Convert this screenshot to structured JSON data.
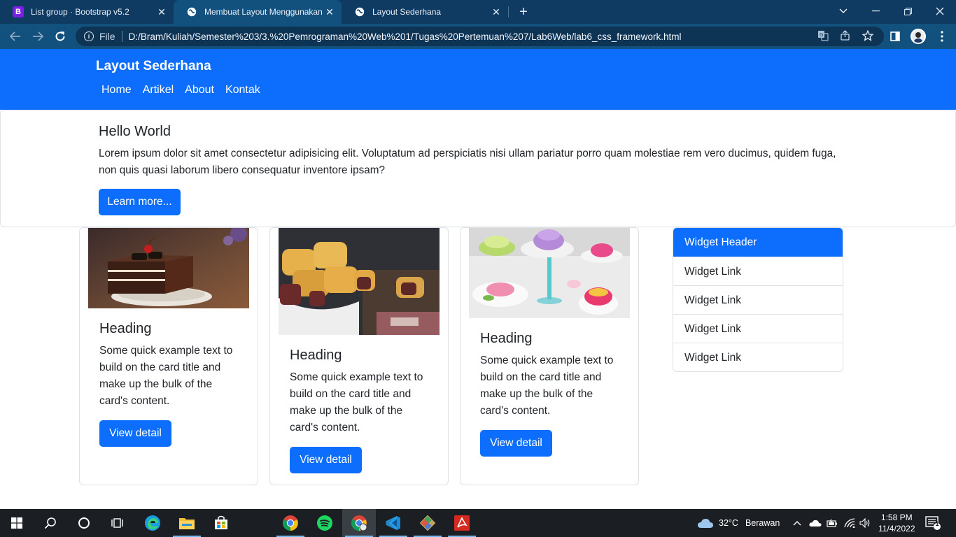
{
  "browser": {
    "tabs": [
      {
        "title": "List group · Bootstrap v5.2",
        "favicon": "bootstrap-icon",
        "close": "✕"
      },
      {
        "title": "Membuat Layout Menggunakan",
        "favicon": "globe-icon",
        "close": "✕"
      },
      {
        "title": "Layout Sederhana",
        "favicon": "globe-icon",
        "close": "✕"
      }
    ],
    "new_tab": "+",
    "address": {
      "scheme_label": "File",
      "url": "D:/Bram/Kuliah/Semester%203/3.%20Pemrograman%20Web%201/Tugas%20Pertemuan%207/Lab6Web/lab6_css_framework.html"
    },
    "icons": [
      "back-arrow-icon",
      "forward-arrow-icon",
      "reload-icon",
      "info-icon",
      "translate-icon",
      "share-icon",
      "star-icon",
      "side-panel-icon",
      "profile-avatar",
      "kebab-menu-icon"
    ]
  },
  "site": {
    "brand": "Layout Sederhana",
    "nav": [
      "Home",
      "Artikel",
      "About",
      "Kontak"
    ]
  },
  "hero": {
    "title": "Hello World",
    "text": "Lorem ipsum dolor sit amet consectetur adipisicing elit. Voluptatum ad perspiciatis nisi ullam pariatur porro quam molestiae rem vero ducimus, quidem fuga, non quis quasi laborum libero consequatur inventore ipsam?",
    "button": "Learn more..."
  },
  "cards": [
    {
      "image": "chocolate-cake-photo",
      "heading": "Heading",
      "text": "Some quick example text to build on the card title and make up the bulk of the card's content.",
      "button": "View detail"
    },
    {
      "image": "pineapple-tart-photo",
      "heading": "Heading",
      "text": "Some quick example text to build on the card title and make up the bulk of the card's content.",
      "button": "View detail"
    },
    {
      "image": "cake-buffet-photo",
      "heading": "Heading",
      "text": "Some quick example text to build on the card title and make up the bulk of the card's content.",
      "button": "View detail"
    }
  ],
  "widget": {
    "header": "Widget Header",
    "links": [
      "Widget Link",
      "Widget Link",
      "Widget Link",
      "Widget Link"
    ]
  },
  "taskbar": {
    "apps": [
      "windows-start-icon",
      "search-icon",
      "cortana-icon",
      "task-view-icon",
      "edge-icon",
      "file-explorer-icon",
      "store-icon",
      "chrome-icon",
      "spotify-icon",
      "chrome-profile-icon",
      "vscode-icon",
      "git-icon",
      "acrobat-icon"
    ],
    "weather": {
      "temp": "32°C",
      "desc": "Berawan"
    },
    "clock": {
      "time": "1:58 PM",
      "date": "11/4/2022"
    },
    "notifications": "1"
  },
  "colors": {
    "primary": "#0d6efd",
    "chrome_dark": "#0f3b63",
    "chrome_toolbar": "#12507e",
    "taskbar": "#1b1f24"
  }
}
